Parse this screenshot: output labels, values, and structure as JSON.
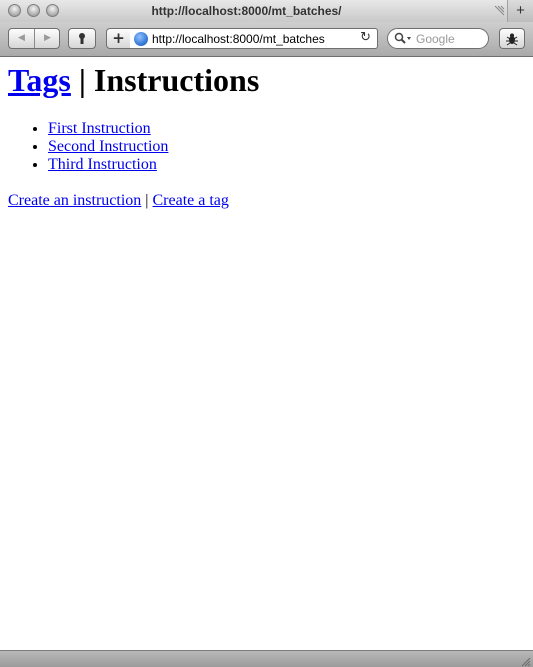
{
  "window": {
    "title": "http://localhost:8000/mt_batches/",
    "new_tab_label": "+"
  },
  "toolbar": {
    "back_label": "◀",
    "forward_label": "▶",
    "add_bookmark_label": "+",
    "url": "http://localhost:8000/mt_batches",
    "reload_icon": "↻",
    "search_placeholder": "Google"
  },
  "page": {
    "heading_link": "Tags",
    "heading_separator": " | ",
    "heading_text": "Instructions",
    "instructions": [
      {
        "label": "First Instruction"
      },
      {
        "label": "Second Instruction"
      },
      {
        "label": "Third Instruction"
      }
    ],
    "create_instruction_label": "Create an instruction",
    "actions_separator": " | ",
    "create_tag_label": "Create a tag"
  },
  "colors": {
    "link": "#0000ee",
    "chrome_top": "#cfcfcf",
    "chrome_bottom": "#a9a9a9"
  }
}
